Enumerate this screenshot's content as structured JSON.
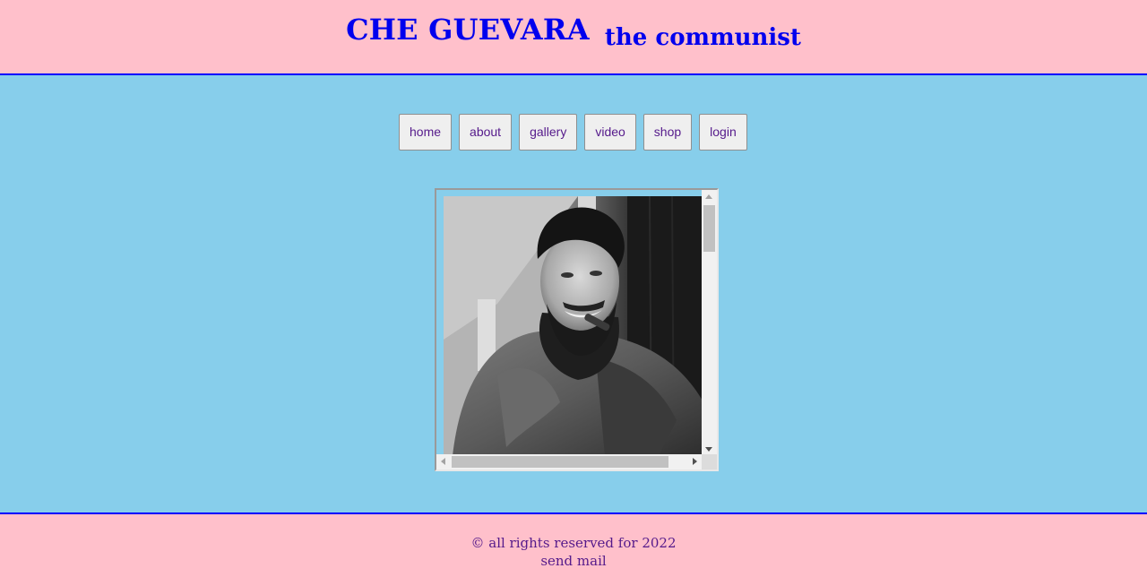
{
  "header": {
    "title_main": "CHE GUEVARA",
    "title_sub": "the communist"
  },
  "nav": {
    "items": [
      {
        "label": "home"
      },
      {
        "label": "about"
      },
      {
        "label": "gallery"
      },
      {
        "label": "video"
      },
      {
        "label": "shop"
      },
      {
        "label": "login"
      }
    ]
  },
  "main": {
    "image": {
      "icon": "portrait-photo",
      "alt": "Che Guevara smiling with cigar"
    }
  },
  "footer": {
    "copyright": "© all rights reserved for 2022",
    "mail_link": "send mail"
  },
  "colors": {
    "header_bg": "#ffc0cb",
    "body_bg": "#87ceeb",
    "title": "#0000ee",
    "divider": "#0000ff",
    "link": "#551a8b"
  }
}
